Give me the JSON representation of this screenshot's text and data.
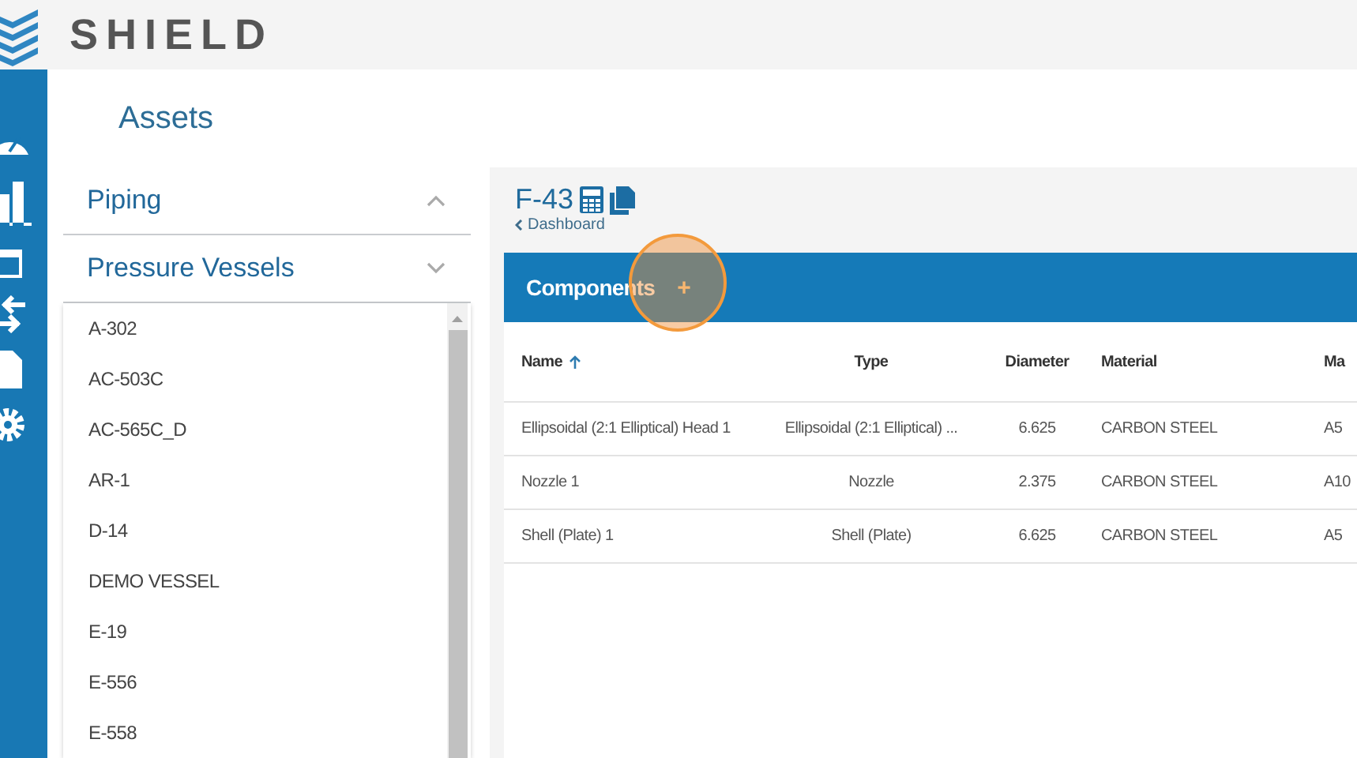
{
  "header": {
    "logo_text": "SHIELD"
  },
  "page": {
    "title": "Assets"
  },
  "asset_groups": [
    {
      "label": "Piping",
      "expanded": false
    },
    {
      "label": "Pressure Vessels",
      "expanded": true
    }
  ],
  "asset_list": [
    "A-302",
    "AC-503C",
    "AC-565C_D",
    "AR-1",
    "D-14",
    "DEMO VESSEL",
    "E-19",
    "E-556",
    "E-558"
  ],
  "detail": {
    "title": "F-43",
    "back_link": "Dashboard",
    "section_title": "Components",
    "add_label": "+"
  },
  "table": {
    "columns": [
      {
        "label": "Name",
        "sorted": true
      },
      {
        "label": "Type"
      },
      {
        "label": "Diameter"
      },
      {
        "label": "Material"
      },
      {
        "label": "Ma"
      }
    ],
    "rows": [
      [
        "Ellipsoidal (2:1 Elliptical) Head 1",
        "Ellipsoidal (2:1 Elliptical) ...",
        "6.625",
        "CARBON STEEL",
        "A5"
      ],
      [
        "Nozzle 1",
        "Nozzle",
        "2.375",
        "CARBON STEEL",
        "A10"
      ],
      [
        "Shell (Plate) 1",
        "Shell (Plate)",
        "6.625",
        "CARBON STEEL",
        "A5"
      ]
    ]
  }
}
